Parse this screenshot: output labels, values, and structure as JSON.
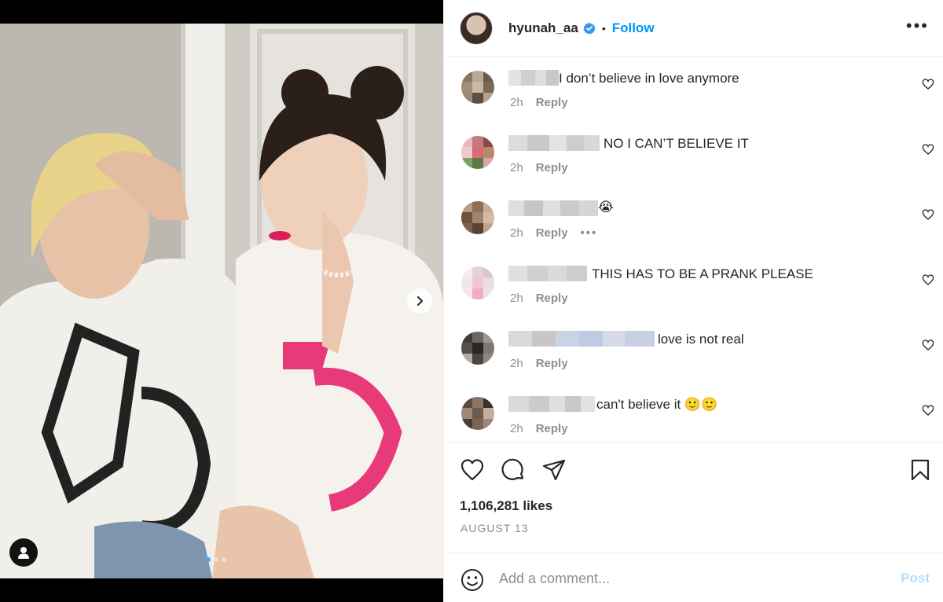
{
  "post": {
    "username": "hyunah_aa",
    "separator": "•",
    "follow_label": "Follow",
    "more_label": "•••",
    "likes": "1,106,281 likes",
    "date": "AUGUST 13"
  },
  "comments": [
    {
      "text": "I don’t believe in love anymore",
      "time": "2h",
      "reply": "Reply",
      "avatar_colors": [
        "#8a7564",
        "#b8a896",
        "#6e5a4a",
        "#a08d7a",
        "#c9b8a6",
        "#7b6857",
        "#9c8978",
        "#5f4d3f",
        "#b2a190"
      ]
    },
    {
      "text": "NO I CAN’T BELIEVE IT",
      "time": "2h",
      "reply": "Reply",
      "avatar_colors": [
        "#e8b7b9",
        "#c5797e",
        "#8b4650",
        "#f0c9c8",
        "#d96b76",
        "#b38a6a",
        "#7ea060",
        "#5d7a45",
        "#d9a3a8"
      ]
    },
    {
      "text": "😭",
      "time": "2h",
      "reply": "Reply",
      "options": "•••",
      "avatar_colors": [
        "#b79c86",
        "#8e6e58",
        "#c7ad98",
        "#6e5241",
        "#a2836c",
        "#d4bba6",
        "#7d6150",
        "#5a4233",
        "#bfa38d"
      ]
    },
    {
      "text": "THIS HAS TO BE A PRANK PLEASE",
      "time": "2h",
      "reply": "Reply",
      "avatar_colors": [
        "#f3eef0",
        "#e4d2da",
        "#d8c4cc",
        "#efe7ea",
        "#f5c3d3",
        "#e8dde2",
        "#fae4ec",
        "#f4a9c4",
        "#ece2e6"
      ]
    },
    {
      "text": "love is not real",
      "time": "2h",
      "reply": "Reply",
      "avatar_colors": [
        "#3e3a36",
        "#6b6660",
        "#9a9691",
        "#55504b",
        "#2b2824",
        "#7d7872",
        "#b0aca6",
        "#4a4541",
        "#8c8780"
      ]
    },
    {
      "text": "can't believe it 🙂🙂",
      "time": "2h",
      "reply": "Reply",
      "avatar_colors": [
        "#5b4a40",
        "#8b7466",
        "#3e3029",
        "#a08777",
        "#6e5a4e",
        "#c4ad9d",
        "#4a3a31",
        "#7a6458",
        "#9b8678"
      ]
    }
  ],
  "composer": {
    "placeholder": "Add a comment...",
    "post_label": "Post"
  },
  "colors": {
    "accent": "#0095f6",
    "post_disabled": "#b2dffc",
    "verified": "#3897f0"
  }
}
